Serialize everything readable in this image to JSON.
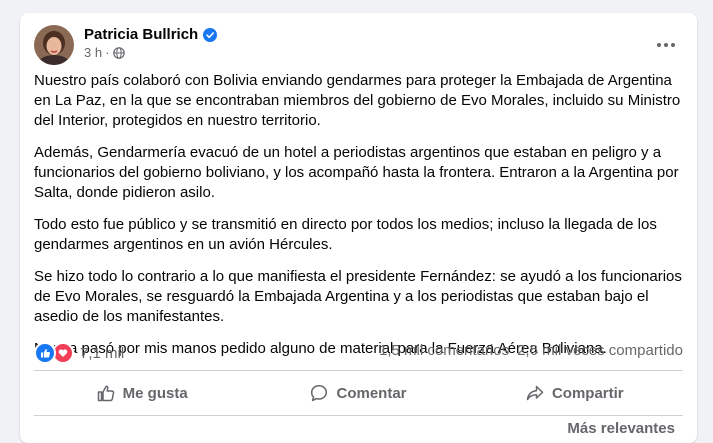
{
  "post": {
    "author": "Patricia Bullrich",
    "time": "3 h",
    "dot": "·",
    "paragraphs": [
      "Nuestro país colaboró con Bolivia enviando gendarmes para proteger la Embajada de Argentina en La Paz, en la que se encontraban miembros del gobierno de Evo Morales, incluido su Ministro del Interior, protegidos en nuestro territorio.",
      "Además, Gendarmería evacuó de un hotel a periodistas argentinos que estaban en peligro y a funcionarios del gobierno boliviano, y los acompañó hasta la frontera. Entraron a la Argentina por Salta, donde pidieron asilo.",
      "Todo esto fue público y se transmitió en directo por todos los medios; incluso la llegada de los gendarmes argentinos en un avión Hércules.",
      "Se hizo todo lo contrario a lo que manifiesta el presidente Fernández: se ayudó a los funcionarios de Evo Morales, se resguardó la Embajada Argentina y a los periodistas que estaban bajo el asedio de los manifestantes.",
      "Nunca pasó por mis manos pedido alguno de material para la Fuerza Aérea Boliviana."
    ]
  },
  "stats": {
    "reactions": "7,1 mil",
    "comments": "1,5 mil comentarios",
    "shares": "2,6 mil veces compartido"
  },
  "actions": {
    "like": "Me gusta",
    "comment": "Comentar",
    "share": "Compartir"
  },
  "sort": "Más relevantes",
  "colors": {
    "accent": "#1877f2",
    "love": "#f33e58",
    "secondary_text": "#65676b"
  }
}
